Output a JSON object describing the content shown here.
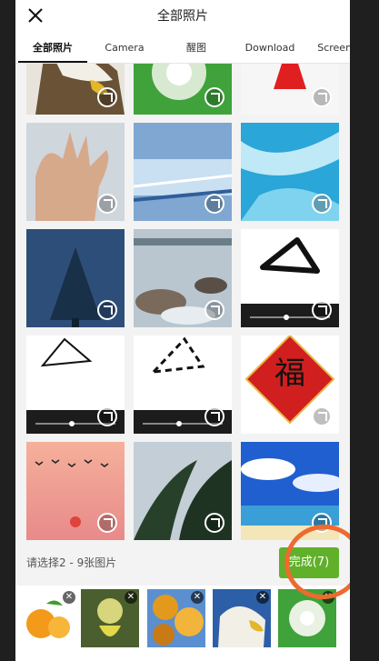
{
  "header": {
    "close_icon": "close-icon",
    "title": "全部照片"
  },
  "tabs": [
    {
      "label": "全部照片",
      "active": true
    },
    {
      "label": "Camera",
      "active": false
    },
    {
      "label": "醒图",
      "active": false
    },
    {
      "label": "Download",
      "active": false
    },
    {
      "label": "Screens",
      "active": false
    }
  ],
  "grid": {
    "photos": [
      {
        "subject": "eagle-head"
      },
      {
        "subject": "dandelion-green"
      },
      {
        "subject": "red-shape"
      },
      {
        "subject": "open-hand"
      },
      {
        "subject": "blue-motion-blur"
      },
      {
        "subject": "blue-ice-water"
      },
      {
        "subject": "pine-tree-night"
      },
      {
        "subject": "misty-rocks-sea"
      },
      {
        "subject": "drawn-triangle"
      },
      {
        "subject": "drawn-triangle-thin"
      },
      {
        "subject": "drawn-triangle-dashed"
      },
      {
        "subject": "fu-character-card"
      },
      {
        "subject": "birds-sunset"
      },
      {
        "subject": "palm-leaves"
      },
      {
        "subject": "sky-beach-clouds"
      }
    ],
    "fu_char": "福"
  },
  "bottom": {
    "hint": "请选择2 - 9张图片",
    "done_label": "完成(7)"
  },
  "tray": {
    "thumbs": [
      {
        "subject": "oranges"
      },
      {
        "subject": "shower-flower"
      },
      {
        "subject": "autumn-leaves"
      },
      {
        "subject": "eagle-head"
      },
      {
        "subject": "dandelion-green"
      }
    ],
    "remove_glyph": "✕"
  },
  "colors": {
    "done_green": "#60b02a",
    "annotation_orange": "#ee6a2f"
  }
}
